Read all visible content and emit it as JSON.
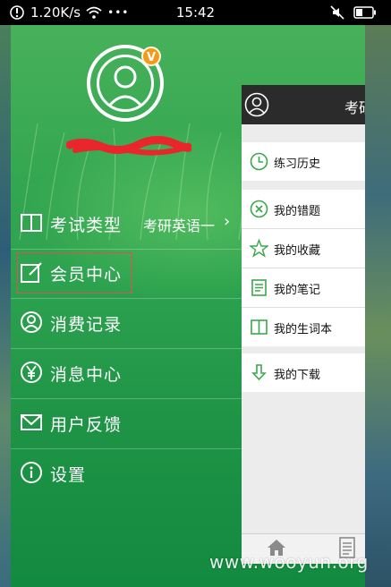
{
  "status_bar": {
    "speed": "1.20K/s",
    "time": "15:42",
    "dots": "•••"
  },
  "drawer": {
    "vip_badge": "V",
    "menu": [
      {
        "label": "考试类型",
        "value": "考研英语一",
        "chevron": "›",
        "icon": "book-icon"
      },
      {
        "label": "会员中心",
        "icon": "edit-icon"
      },
      {
        "label": "消费记录",
        "icon": "user-record-icon"
      },
      {
        "label": "消息中心",
        "icon": "yen-icon"
      },
      {
        "label": "用户反馈",
        "icon": "mail-icon"
      },
      {
        "label": "设置",
        "icon": "info-icon"
      }
    ]
  },
  "panel": {
    "header_title": "考研",
    "rows": [
      {
        "label": "练习历史",
        "icon": "clock-icon"
      },
      {
        "label": "我的错题",
        "icon": "x-circle-icon"
      },
      {
        "label": "我的收藏",
        "icon": "star-icon"
      },
      {
        "label": "我的笔记",
        "icon": "note-icon"
      },
      {
        "label": "我的生词本",
        "icon": "book-icon"
      },
      {
        "label": "我的下载",
        "icon": "download-icon"
      }
    ]
  },
  "watermark": "www.wooyun.org",
  "colors": {
    "drawer_green": "#2da24f",
    "panel_header": "#2b2b2b",
    "icon_green": "#3aa84a",
    "highlight_border": "#d9534f",
    "vip_orange": "#f39a1a"
  }
}
